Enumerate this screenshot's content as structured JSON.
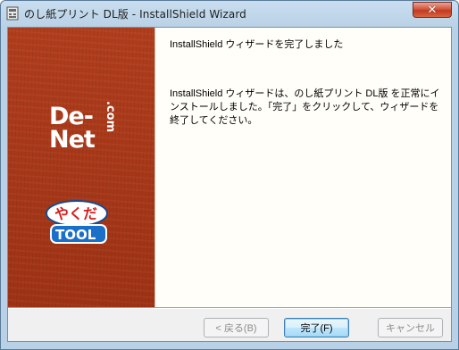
{
  "window": {
    "title": "のし紙プリント DL版 - InstallShield Wizard",
    "close_symbol": "✕"
  },
  "banner": {
    "logo_text": "De-Net .com",
    "tool_text": "やくだ TOOL"
  },
  "panel": {
    "heading": "InstallShield ウィザードを完了しました",
    "body": "InstallShield ウィザードは、のし紙プリント DL版 を正常にインストールしました。「完了」をクリックして、ウィザードを終了してください。"
  },
  "buttons": {
    "back": "< 戻る(B)",
    "finish": "完了(F)",
    "cancel": "キャンセル"
  },
  "colors": {
    "banner_red": "#a83a1a",
    "panel_bg": "#fffef8"
  },
  "icons": [
    "installer-icon",
    "close-icon",
    "denet-logo",
    "yakuda-tool-logo"
  ]
}
